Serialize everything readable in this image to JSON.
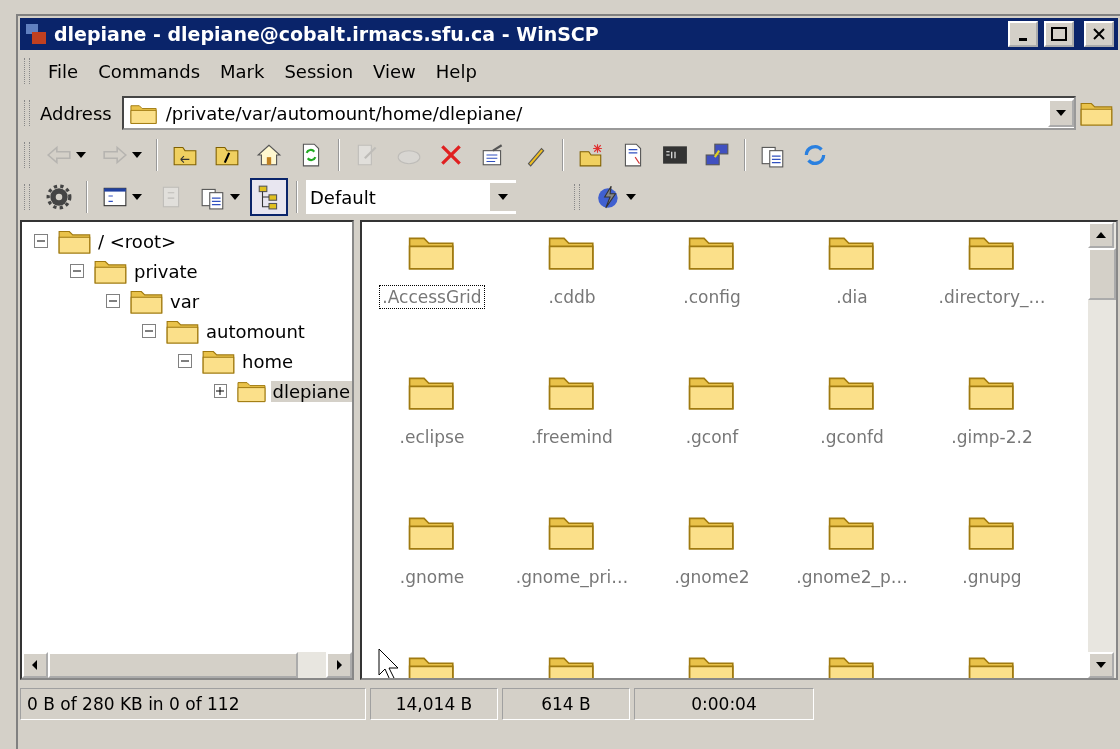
{
  "window": {
    "title": "dlepiane - dlepiane@cobalt.irmacs.sfu.ca - WinSCP"
  },
  "menu": [
    "File",
    "Commands",
    "Mark",
    "Session",
    "View",
    "Help"
  ],
  "address": {
    "label": "Address",
    "value": "/private/var/automount/home/dlepiane/"
  },
  "toolbar": [
    {
      "kind": "back",
      "disabled": true,
      "dropdown": true
    },
    {
      "kind": "forward",
      "disabled": true,
      "dropdown": true
    },
    {
      "kind": "separator"
    },
    {
      "kind": "parent",
      "disabled": false
    },
    {
      "kind": "root",
      "disabled": false
    },
    {
      "kind": "home",
      "disabled": false
    },
    {
      "kind": "refresh",
      "disabled": false
    },
    {
      "kind": "separator"
    },
    {
      "kind": "edit",
      "disabled": true
    },
    {
      "kind": "open",
      "disabled": true
    },
    {
      "kind": "delete",
      "disabled": false
    },
    {
      "kind": "properties",
      "disabled": false
    },
    {
      "kind": "rename",
      "disabled": false
    },
    {
      "kind": "separator"
    },
    {
      "kind": "newfolder",
      "disabled": false
    },
    {
      "kind": "link",
      "disabled": false
    },
    {
      "kind": "console",
      "disabled": false
    },
    {
      "kind": "session",
      "disabled": false
    },
    {
      "kind": "separator"
    },
    {
      "kind": "copy",
      "disabled": false
    },
    {
      "kind": "sync",
      "disabled": false
    }
  ],
  "toolbar2": [
    {
      "kind": "gear",
      "disabled": false
    },
    {
      "kind": "separator"
    },
    {
      "kind": "view",
      "disabled": false,
      "dropdown": true
    },
    {
      "kind": "queue",
      "disabled": true
    },
    {
      "kind": "copy",
      "disabled": false,
      "dropdown": true
    },
    {
      "kind": "tree",
      "disabled": false,
      "pressed": true
    }
  ],
  "preset": {
    "value": "Default"
  },
  "tree": [
    {
      "label": "/ <root>",
      "expanded": true,
      "selected": false,
      "children": [
        {
          "label": "private",
          "expanded": true,
          "selected": false,
          "children": [
            {
              "label": "var",
              "expanded": true,
              "selected": false,
              "children": [
                {
                  "label": "automount",
                  "expanded": true,
                  "selected": false,
                  "children": [
                    {
                      "label": "home",
                      "expanded": true,
                      "selected": false,
                      "children": [
                        {
                          "label": "dlepiane",
                          "expanded": false,
                          "selected": true
                        }
                      ]
                    }
                  ]
                }
              ]
            }
          ]
        }
      ]
    }
  ],
  "files": [
    {
      "kind": "folder",
      "name": ".AccessGrid",
      "focused": true
    },
    {
      "kind": "folder",
      "name": ".cddb",
      "focused": false
    },
    {
      "kind": "folder",
      "name": ".config",
      "focused": false
    },
    {
      "kind": "folder",
      "name": ".dia",
      "focused": false
    },
    {
      "kind": "folder",
      "name": ".directory_…",
      "focused": false
    },
    {
      "kind": "folder",
      "name": ".eclipse",
      "focused": false
    },
    {
      "kind": "folder",
      "name": ".freemind",
      "focused": false
    },
    {
      "kind": "folder",
      "name": ".gconf",
      "focused": false
    },
    {
      "kind": "folder",
      "name": ".gconfd",
      "focused": false
    },
    {
      "kind": "folder",
      "name": ".gimp-2.2",
      "focused": false
    },
    {
      "kind": "folder",
      "name": ".gnome",
      "focused": false
    },
    {
      "kind": "folder",
      "name": ".gnome_pri…",
      "focused": false
    },
    {
      "kind": "folder",
      "name": ".gnome2",
      "focused": false
    },
    {
      "kind": "folder",
      "name": ".gnome2_p…",
      "focused": false
    },
    {
      "kind": "folder",
      "name": ".gnupg",
      "focused": false
    },
    {
      "kind": "folder"
    },
    {
      "kind": "folder"
    },
    {
      "kind": "folder"
    },
    {
      "kind": "folder"
    },
    {
      "kind": "folder"
    }
  ],
  "status_bar": [
    "0 B of 280 KB in 0 of 112",
    "14,014 B",
    "614 B",
    "0:00:04"
  ]
}
